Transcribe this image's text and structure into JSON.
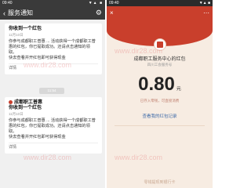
{
  "left": {
    "status_time": "09:40",
    "status_right": "▼▲ ■",
    "nav_title": "服务通知",
    "card1": {
      "sender": "成都职工普惠",
      "title": "你收到一个红包",
      "date": "11月10日",
      "text": "你参与成都职工普惠 ... 活动获得一个成都职工普惠的红包，你已提取成功。还请点击通知的领取。",
      "cta": "快去查看并开红包即可获得现金",
      "detail": "详情"
    },
    "chip1": "11:54",
    "card2": {
      "sender": "成都职工普惠",
      "title": "你收到一个红包",
      "date": "11月10日",
      "text": "你参与成都职工普惠 ... 活动获得一个成都职工普惠的红包，你已提取成功。还请点击通知的领取。",
      "cta": "快去查看并开红包即可获得现金",
      "detail": "详情"
    }
  },
  "right": {
    "status_time": "09:40",
    "status_right": "▼▲ ■",
    "sender": "成都职工服务中心的红包",
    "subtitle": "四川工会服务号",
    "amount": "0.80",
    "unit": "元",
    "note": "已存入零钱，可直接消费",
    "link": "查看我的红包记录",
    "footer": "零钱提现到银行卡"
  },
  "watermark": "www.dir28.com"
}
